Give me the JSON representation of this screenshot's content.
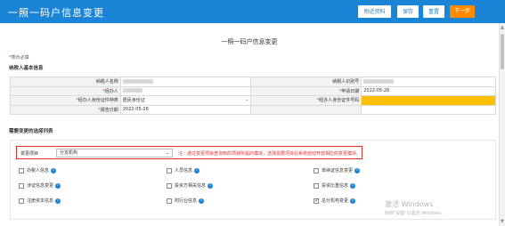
{
  "header": {
    "title": "一照一码户信息变更",
    "buttons": {
      "reselect": "附近资料",
      "save": "保存",
      "reset": "重置",
      "next": "下一步"
    }
  },
  "form": {
    "title": "一照一码户信息变更",
    "required_note": "表示必填",
    "required_star": "*",
    "section_basic": "纳税人基本信息",
    "rows": {
      "taxpayer_name_label": "纳税人名称",
      "taxpayer_id_label": "纳税人识别号",
      "agent_label": "经办人",
      "apply_date_label": "申请日期",
      "apply_date_value": "2022-05-26",
      "agent_id_type_label": "经办人身份证件种类",
      "agent_id_type_value": "居民身份证",
      "agent_id_no_label": "经办人身份证件号码",
      "report_date_label": "报告日期",
      "report_date_value": "2022-05-26"
    },
    "section_change": "需要变更的选择列表",
    "change_item_label": "变更项目",
    "change_item_value": "分支机构",
    "change_hint": "注：通过变更项目查询到的项目所属的模块，选择需要项目后系统自动开放相应的变更模块。",
    "checkboxes": [
      {
        "label": "办税人信息",
        "checked": false
      },
      {
        "label": "人员信息",
        "checked": false
      },
      {
        "label": "单纳证信息变更",
        "checked": false
      },
      {
        "label": "涉证信息变更",
        "checked": false
      },
      {
        "label": "投资方相关信息",
        "checked": false
      },
      {
        "label": "投资比重信息",
        "checked": false
      },
      {
        "label": "注册资本信息",
        "checked": false
      },
      {
        "label": "附行业信息",
        "checked": false
      },
      {
        "label": "总分机构变更",
        "checked": true
      }
    ]
  },
  "watermark": {
    "line1": "激活 Windows",
    "line2": "转到\"设置\"以激活 Windows。"
  },
  "colors": {
    "header_blue": "#1a84d6",
    "next_orange": "#ff8a00",
    "required_red": "#e03030",
    "highlight_yellow": "#ffc000"
  }
}
